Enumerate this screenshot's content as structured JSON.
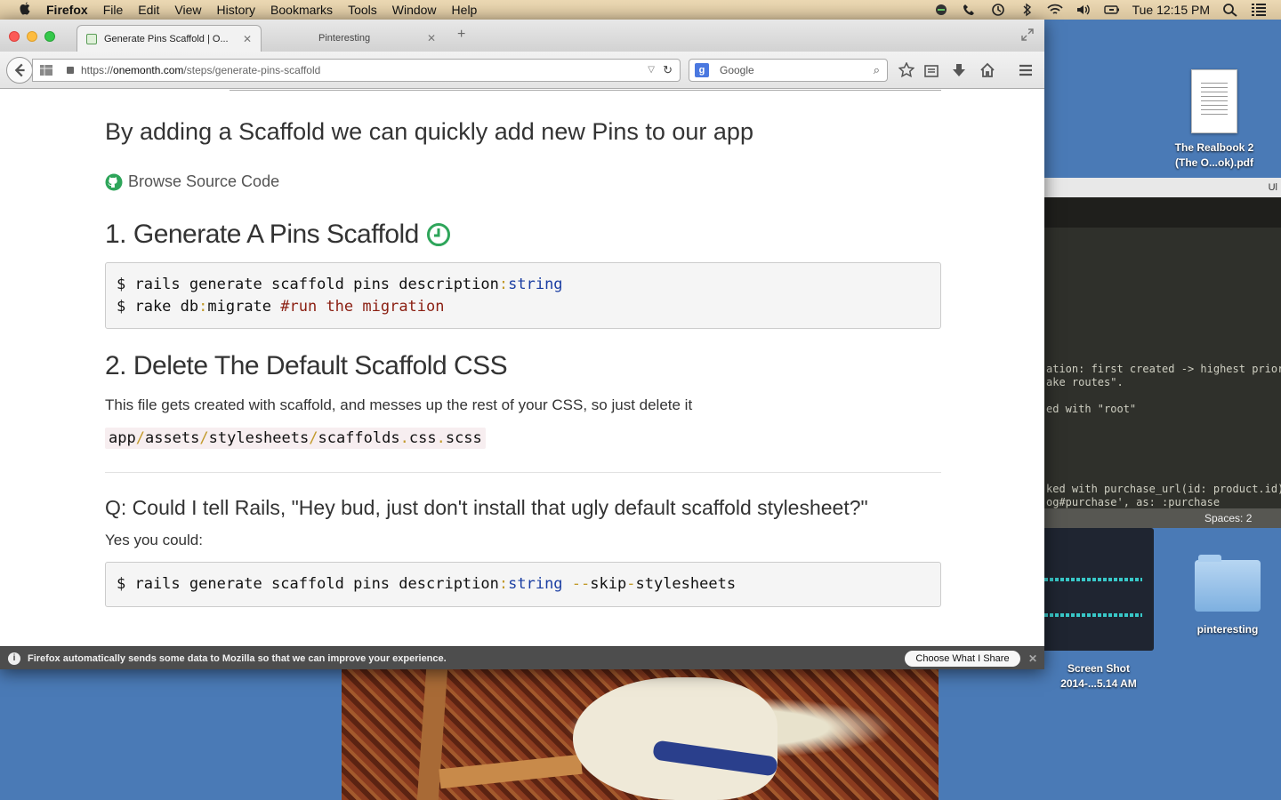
{
  "menubar": {
    "app": "Firefox",
    "items": [
      "File",
      "Edit",
      "View",
      "History",
      "Bookmarks",
      "Tools",
      "Window",
      "Help"
    ],
    "clock": "Tue 12:15 PM"
  },
  "desktop": {
    "realbook_label_line1": "The Realbook 2",
    "realbook_label_line2": "(The O...ok).pdf",
    "folder_label": "pinteresting",
    "screenshot_label_line1": "Screen Shot",
    "screenshot_label_line2": "2014-...5.14 AM"
  },
  "editor": {
    "title_fragment": "Ul",
    "lines": [
      "ation: first created -> highest priori",
      "ake routes\".",
      "",
      "ed with \"root\"",
      "",
      "",
      "",
      "",
      "ked with purchase_url(id: product.id)",
      "og#purchase', as: :purchase"
    ],
    "status": "Spaces: 2"
  },
  "browser": {
    "tabs": [
      {
        "label": "Generate Pins Scaffold | O...",
        "active": true
      },
      {
        "label": "Pinteresting",
        "active": false
      }
    ],
    "url_scheme": "https://",
    "url_host": "onemonth.com",
    "url_path": "/steps/generate-pins-scaffold",
    "search_placeholder": "Google"
  },
  "page": {
    "lead": "By adding a Scaffold we can quickly add new Pins to our app",
    "browse_link": "Browse Source Code",
    "h1": "1. Generate A Pins Scaffold",
    "code1_line1": [
      "$ rails generate scaffold pins description",
      ":",
      "string"
    ],
    "code1_line2": [
      "$ rake db",
      ":",
      "migrate ",
      "#run the migration"
    ],
    "h2": "2. Delete The Default Scaffold CSS",
    "paragraph": "This file gets created with scaffold, and messes up the rest of your CSS, so just delete it",
    "inline_code": [
      "app",
      "/",
      "assets",
      "/",
      "stylesheets",
      "/",
      "scaffolds",
      ".",
      "css",
      ".",
      "scss"
    ],
    "question": "Q: Could I tell Rails, \"Hey bud, just don't install that ugly default scaffold stylesheet?\"",
    "answer": "Yes you could:",
    "code2": [
      "$ rails generate scaffold pins description",
      ":",
      "string",
      " ",
      "--",
      "skip",
      "-",
      "stylesheets"
    ]
  },
  "notification": {
    "message": "Firefox automatically sends some data to Mozilla so that we can improve your experience.",
    "button": "Choose What I Share"
  },
  "colors": {
    "desktop": "#4a7ab6",
    "heading_icon_green": "#2ea55a",
    "code_keyword": "#1c3fa3",
    "code_comment": "#8b1f12"
  }
}
